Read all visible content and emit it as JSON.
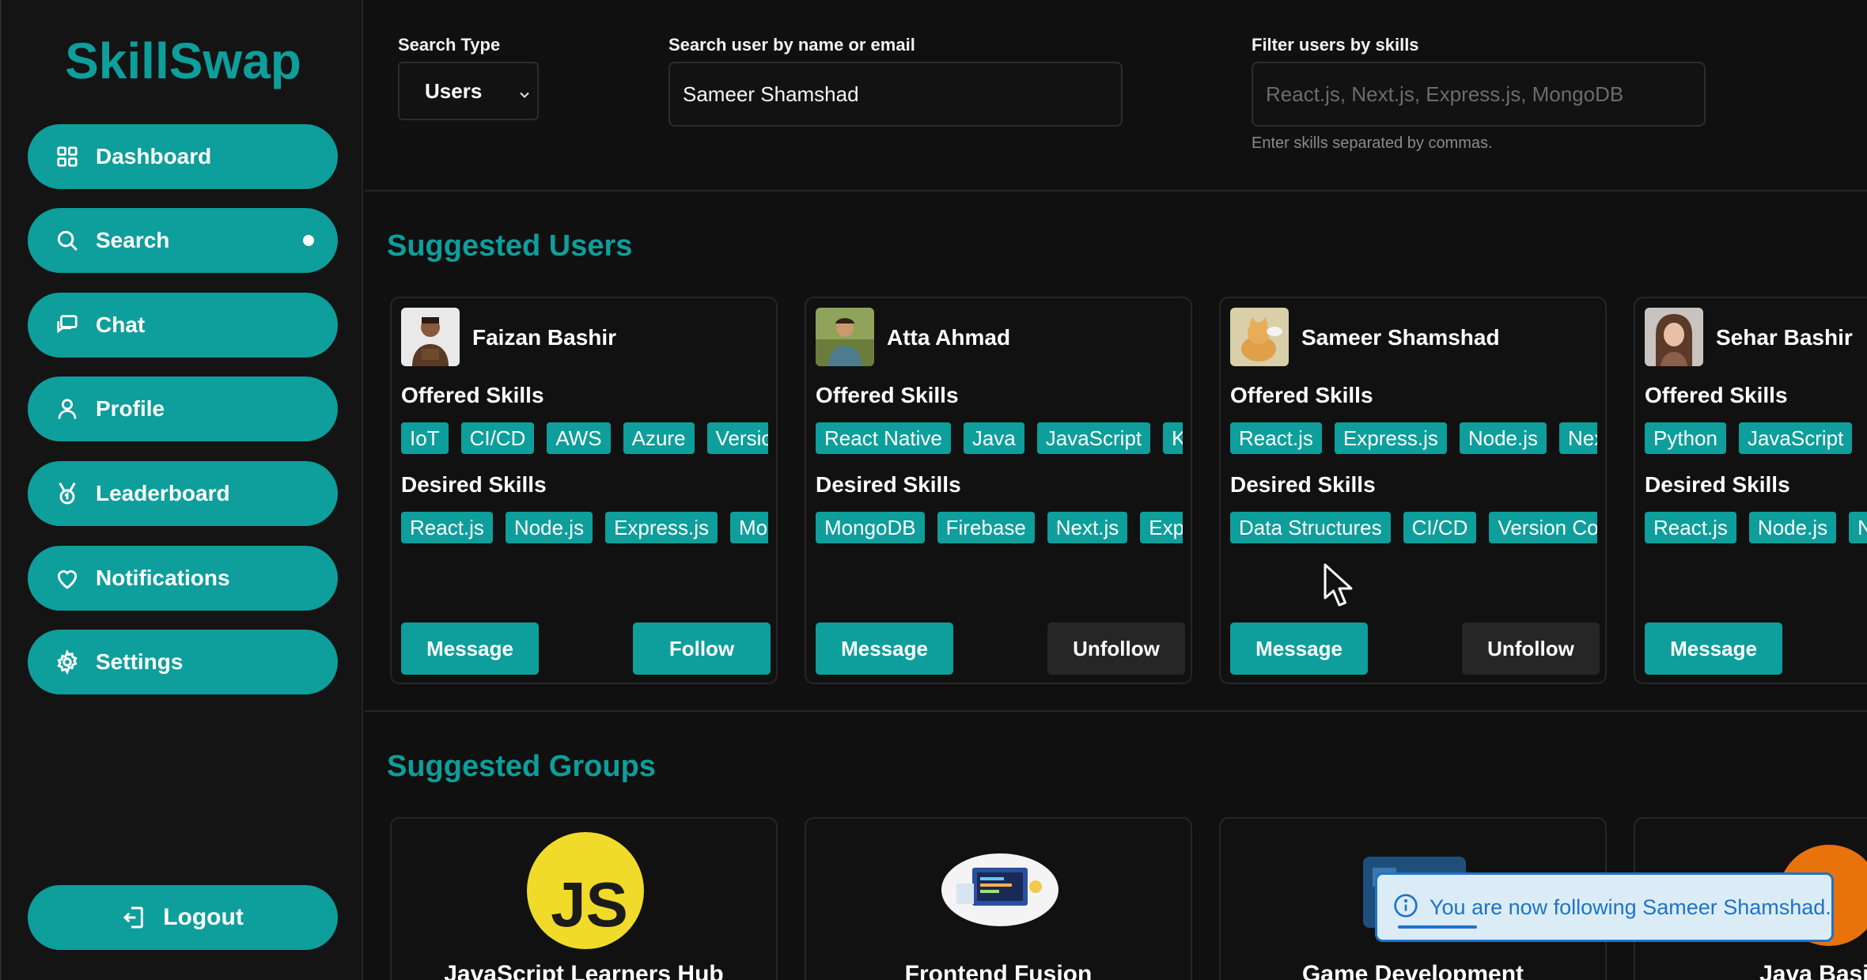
{
  "app": {
    "name": "SkillSwap"
  },
  "sidebar": {
    "items": [
      {
        "label": "Dashboard",
        "icon": "dashboard-grid-icon"
      },
      {
        "label": "Search",
        "icon": "search-icon",
        "active": true
      },
      {
        "label": "Chat",
        "icon": "chat-icon"
      },
      {
        "label": "Profile",
        "icon": "user-icon"
      },
      {
        "label": "Leaderboard",
        "icon": "trophy-icon"
      },
      {
        "label": "Notifications",
        "icon": "heart-icon"
      },
      {
        "label": "Settings",
        "icon": "gear-icon"
      }
    ],
    "logout_label": "Logout"
  },
  "search": {
    "type_label": "Search Type",
    "type_value": "Users",
    "query_label": "Search user by name or email",
    "query_value": "Sameer Shamshad",
    "skills_label": "Filter users by skills",
    "skills_placeholder": "React.js, Next.js, Express.js, MongoDB",
    "skills_hint": "Enter skills separated by commas."
  },
  "suggested_users": {
    "title": "Suggested Users",
    "offered_heading": "Offered Skills",
    "desired_heading": "Desired Skills",
    "users": [
      {
        "name": "Faizan Bashir",
        "offered": [
          "IoT",
          "CI/CD",
          "AWS",
          "Azure",
          "Version Control"
        ],
        "desired": [
          "React.js",
          "Node.js",
          "Express.js",
          "MongoDB"
        ],
        "message_label": "Message",
        "follow_label": "Follow"
      },
      {
        "name": "Atta Ahmad",
        "offered": [
          "React Native",
          "Java",
          "JavaScript",
          "Kotlin"
        ],
        "desired": [
          "MongoDB",
          "Firebase",
          "Next.js",
          "Express.js"
        ],
        "message_label": "Message",
        "follow_label": "Unfollow"
      },
      {
        "name": "Sameer Shamshad",
        "offered": [
          "React.js",
          "Express.js",
          "Node.js",
          "Next.js"
        ],
        "desired": [
          "Data Structures",
          "CI/CD",
          "Version Control"
        ],
        "message_label": "Message",
        "follow_label": "Unfollow"
      },
      {
        "name": "Sehar Bashir",
        "offered": [
          "Python",
          "JavaScript"
        ],
        "desired": [
          "React.js",
          "Node.js",
          "Next.js"
        ],
        "message_label": "Message",
        "follow_label": ""
      }
    ]
  },
  "suggested_groups": {
    "title": "Suggested Groups",
    "groups": [
      {
        "name": "JavaScript Learners Hub"
      },
      {
        "name": "Frontend Fusion"
      },
      {
        "name": "Game Development"
      },
      {
        "name": "Java Basics"
      }
    ]
  },
  "toast": {
    "message": "You are now following Sameer Shamshad."
  },
  "colors": {
    "accent": "#0e9e9b",
    "background": "#101010",
    "toast_blue": "#1e73c8"
  }
}
